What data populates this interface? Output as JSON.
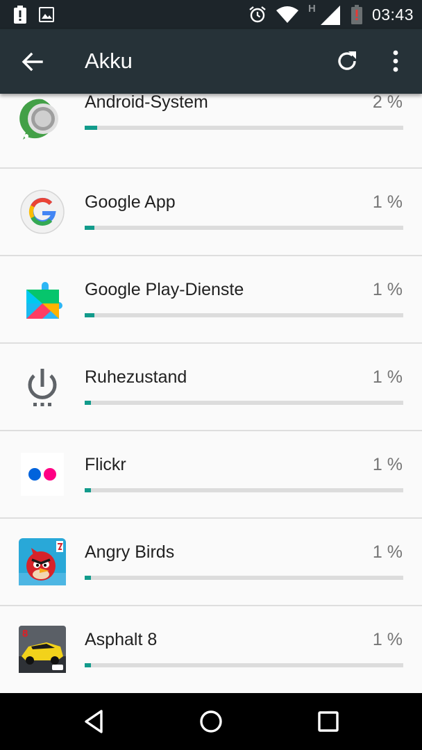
{
  "status_bar": {
    "time": "03:43",
    "network_letter": "H",
    "icons": [
      "alert-icon",
      "image-notification-icon",
      "alarm-icon",
      "wifi-icon",
      "cellular-signal-icon",
      "battery-low-icon"
    ]
  },
  "toolbar": {
    "title": "Akku",
    "icons": [
      "back-arrow-icon",
      "refresh-icon",
      "more-vert-icon"
    ]
  },
  "apps": [
    {
      "name": "Android-System",
      "percent_text": "2 %",
      "usage_fraction": 0.04,
      "icon": "android-system-icon"
    },
    {
      "name": "Google App",
      "percent_text": "1 %",
      "usage_fraction": 0.03,
      "icon": "google-app-icon"
    },
    {
      "name": "Google Play-Dienste",
      "percent_text": "1 %",
      "usage_fraction": 0.03,
      "icon": "google-play-services-icon"
    },
    {
      "name": "Ruhezustand",
      "percent_text": "1 %",
      "usage_fraction": 0.02,
      "icon": "power-idle-icon"
    },
    {
      "name": "Flickr",
      "percent_text": "1 %",
      "usage_fraction": 0.02,
      "icon": "flickr-icon"
    },
    {
      "name": "Angry Birds",
      "percent_text": "1 %",
      "usage_fraction": 0.02,
      "icon": "angry-birds-icon"
    },
    {
      "name": "Asphalt 8",
      "percent_text": "1 %",
      "usage_fraction": 0.02,
      "icon": "asphalt-8-icon"
    }
  ],
  "nav_bar": {
    "icons": [
      "back-triangle-icon",
      "home-circle-icon",
      "recents-square-icon"
    ]
  },
  "colors": {
    "toolbar": "#263238",
    "status_bar": "#1d252a",
    "accent": "#129b8b",
    "track": "#dcdcdc"
  }
}
